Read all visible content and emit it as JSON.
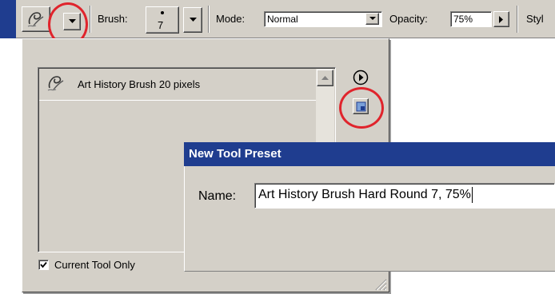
{
  "options_bar": {
    "tool_icon": "art-history-brush-icon",
    "tool_picker_arrow": "chevron-down-icon",
    "brush_label": "Brush:",
    "brush_size": "7",
    "mode_label": "Mode:",
    "mode_value": "Normal",
    "opacity_label": "Opacity:",
    "opacity_value": "75%",
    "style_label": "Styl"
  },
  "preset_panel": {
    "items": [
      {
        "label": "Art History Brush 20 pixels",
        "icon": "art-history-brush-icon"
      }
    ],
    "menu_icon": "play-circle-icon",
    "new_preset_icon": "new-preset-icon",
    "current_tool_only_label": "Current Tool Only",
    "current_tool_only_checked": true
  },
  "dialog": {
    "title": "New Tool Preset",
    "name_label": "Name:",
    "name_value": "Art History Brush Hard Round 7, 75%"
  },
  "colors": {
    "title_bar": "#1f3d8f",
    "highlight_circle": "#e0242c",
    "chrome": "#d4d0c8"
  }
}
